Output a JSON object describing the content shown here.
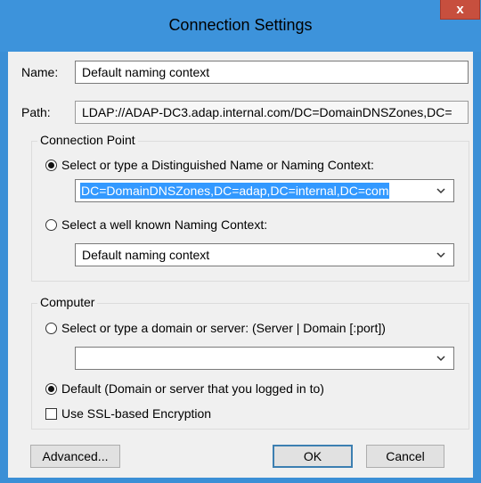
{
  "window": {
    "title": "Connection Settings",
    "close_label": "x"
  },
  "name_field": {
    "label": "Name:",
    "value": "Default naming context"
  },
  "path_field": {
    "label": "Path:",
    "value": "LDAP://ADAP-DC3.adap.internal.com/DC=DomainDNSZones,DC="
  },
  "connection_point": {
    "title": "Connection Point",
    "option_dn": {
      "label": "Select or type a Distinguished Name or Naming Context:",
      "selected": true
    },
    "dn_combo_value": "DC=DomainDNSZones,DC=adap,DC=internal,DC=com",
    "option_known": {
      "label": "Select a well known Naming Context:",
      "selected": false
    },
    "known_combo_value": "Default naming context"
  },
  "computer": {
    "title": "Computer",
    "option_server": {
      "label": "Select or type a domain or server: (Server | Domain [:port])",
      "selected": false
    },
    "server_combo_value": "",
    "option_default": {
      "label": "Default (Domain or server that you logged in to)",
      "selected": true
    },
    "ssl_checkbox": {
      "label": "Use SSL-based Encryption",
      "checked": false
    }
  },
  "buttons": {
    "advanced": "Advanced...",
    "ok": "OK",
    "cancel": "Cancel"
  },
  "colors": {
    "title_bar": "#3d93db",
    "close": "#c74f3e",
    "selection": "#3399ff"
  }
}
